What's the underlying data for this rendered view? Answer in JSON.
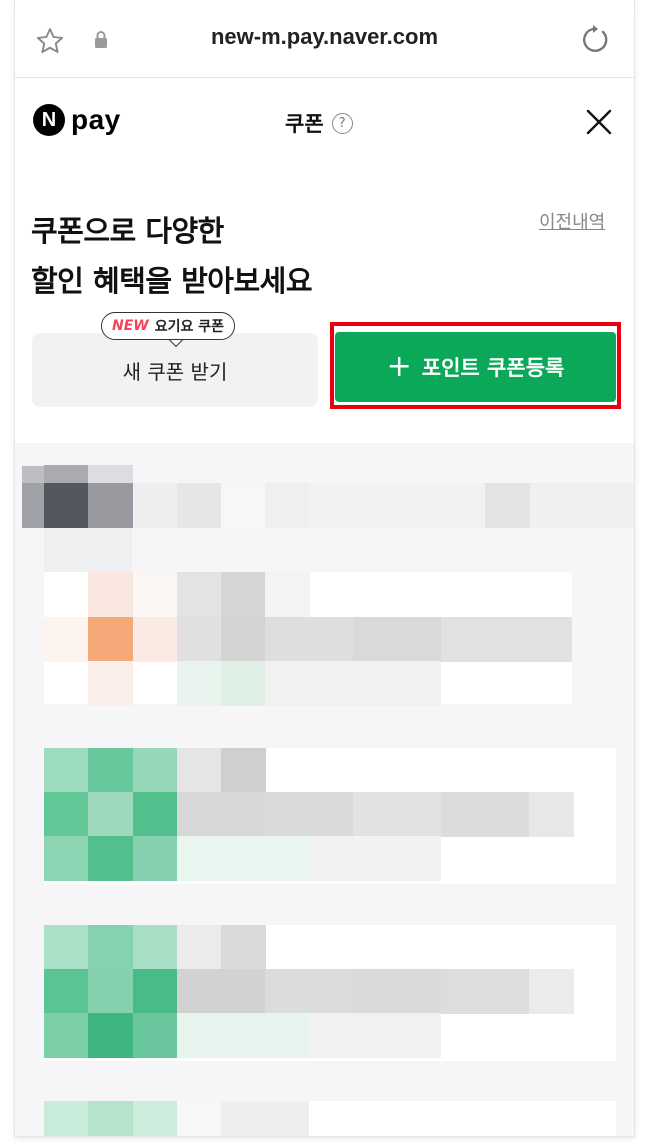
{
  "browser": {
    "url": "new-m.pay.naver.com"
  },
  "header": {
    "logo_mark": "N",
    "logo_text": "pay",
    "title": "쿠폰",
    "help_glyph": "?"
  },
  "hero": {
    "title_line1": "쿠폰으로 다양한",
    "title_line2": "할인 혜택을 받아보세요",
    "history_link": "이전내역"
  },
  "actions": {
    "badge_new": "NEW",
    "badge_text": "요기요 쿠폰",
    "new_coupon_label": "새 쿠폰 받기",
    "register_plus": "+",
    "register_label": "포인트 쿠폰등록"
  },
  "colors": {
    "brand_green": "#0ca859",
    "highlight_red": "#e8000e",
    "badge_red": "#f2455b"
  }
}
